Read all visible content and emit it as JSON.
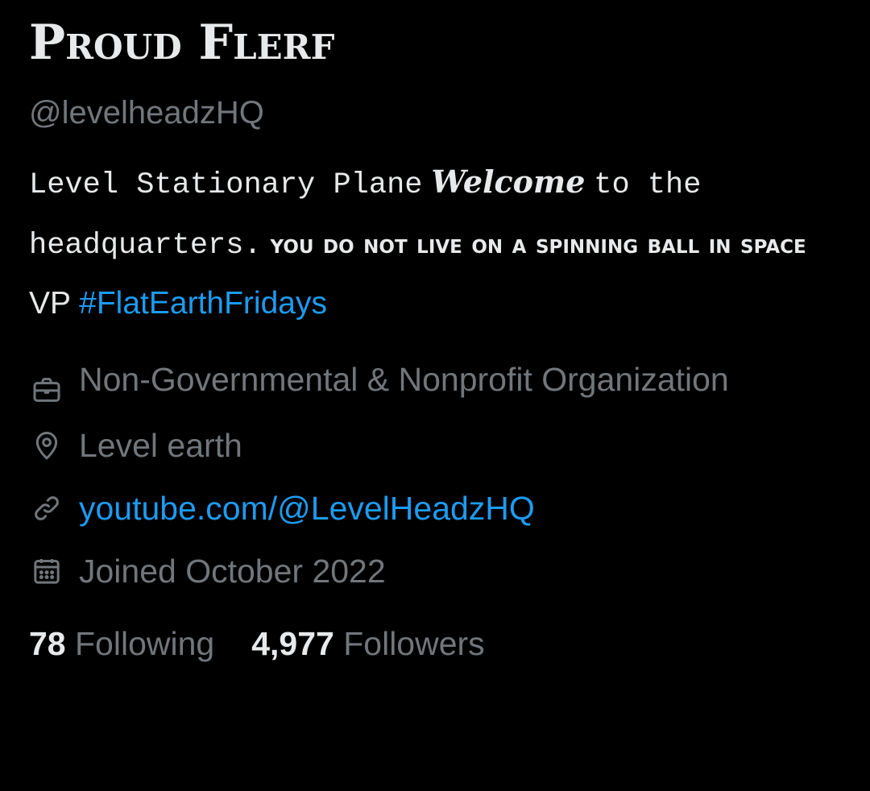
{
  "profile": {
    "display_name": "Proud Flerf",
    "handle": "@levelheadzHQ",
    "bio": {
      "part1": "Level Stationary Plane",
      "part2": "Welcome",
      "part3": "to the headquarters.",
      "part4": "YOU DO NOT LIVE ON A SPINNING BALL IN SPACE",
      "part5": "VP",
      "hashtag": "#FlatEarthFridays"
    },
    "category": "Non-Governmental & Nonprofit Organization",
    "location": "Level earth",
    "url": "youtube.com/@LevelHeadzHQ",
    "joined": "Joined October 2022",
    "following_count": "78",
    "following_label": "Following",
    "followers_count": "4,977",
    "followers_label": "Followers"
  },
  "icons": {
    "category": "briefcase-icon",
    "location": "location-pin-icon",
    "url": "link-icon",
    "joined": "calendar-icon"
  },
  "colors": {
    "background": "#000000",
    "primary_text": "#e7e9ea",
    "secondary_text": "#71767b",
    "link": "#1d9bf0"
  }
}
